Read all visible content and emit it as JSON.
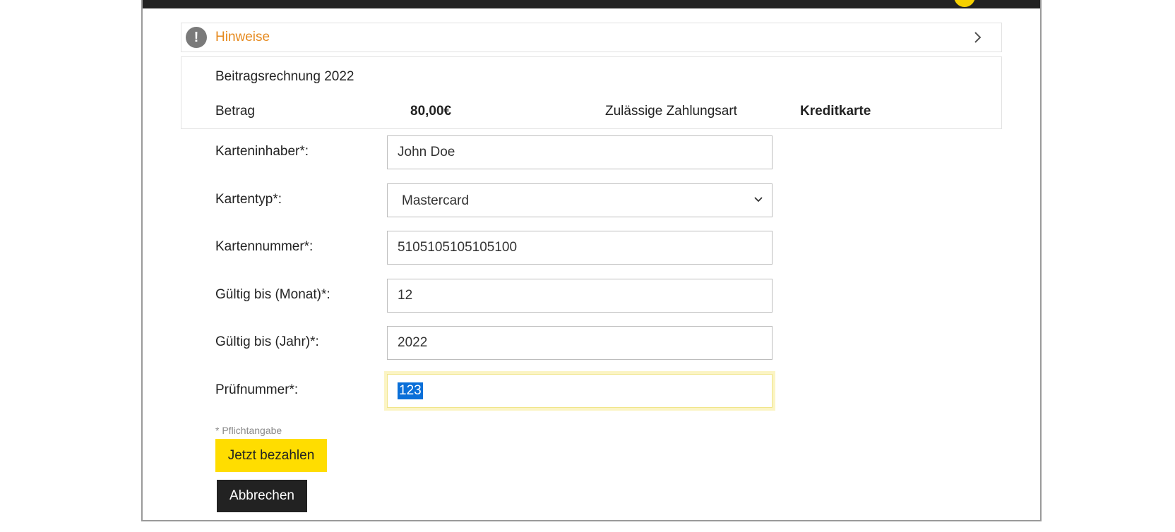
{
  "notice": {
    "label": "Hinweise"
  },
  "invoice": {
    "title": "Beitragsrechnung 2022",
    "amount_label": "Betrag",
    "amount_value": "80,00€",
    "payment_type_label": "Zulässige Zahlungsart",
    "payment_type_value": "Kreditkarte"
  },
  "form": {
    "cardholder": {
      "label": "Karteninhaber*:",
      "value": "John Doe"
    },
    "cardtype": {
      "label": "Kartentyp*:",
      "value": "Mastercard",
      "options": [
        "Mastercard"
      ]
    },
    "cardnumber": {
      "label": "Kartennummer*:",
      "value": "5105105105105100"
    },
    "expiry_month": {
      "label": "Gültig bis (Monat)*:",
      "value": "12"
    },
    "expiry_year": {
      "label": "Gültig bis (Jahr)*:",
      "value": "2022"
    },
    "cvc": {
      "label": "Prüfnummer*:",
      "value": "123"
    },
    "required_note": "* Pflichtangabe"
  },
  "actions": {
    "pay_label": "Jetzt bezahlen",
    "cancel_label": "Abbrechen"
  },
  "colors": {
    "accent_yellow": "#ffdd00",
    "notice_orange": "#e68a1e",
    "dark": "#222222",
    "selection_blue": "#0a6fd8"
  },
  "icons": {
    "notice": "exclamation-circle-icon",
    "notice_toggle": "chevron-right-icon",
    "select_arrow": "chevron-down-icon"
  }
}
